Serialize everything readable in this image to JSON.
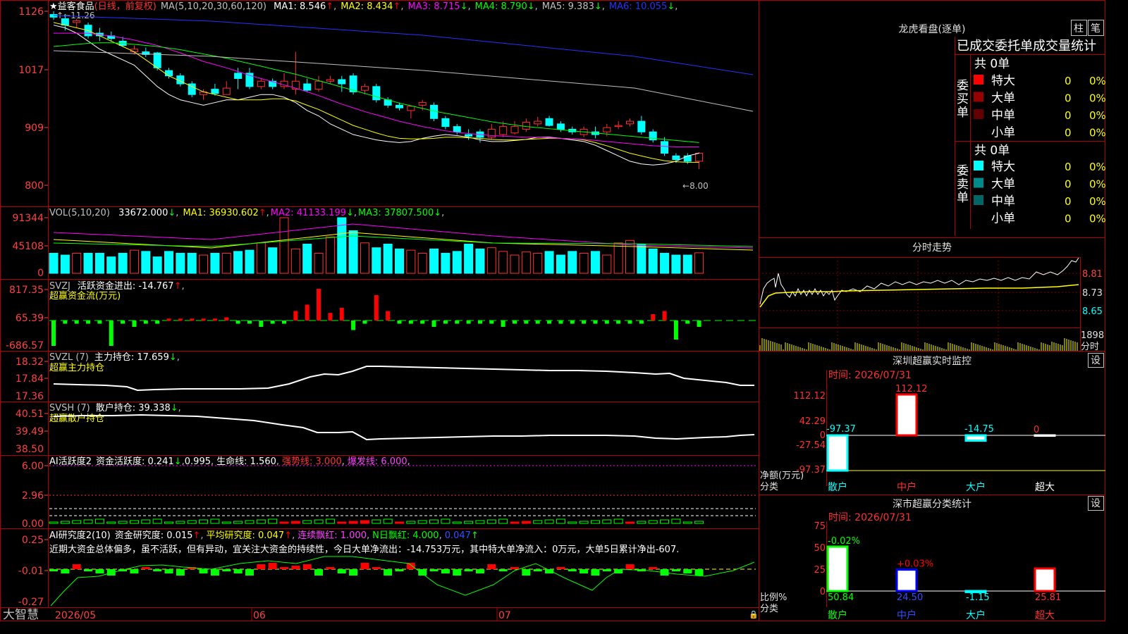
{
  "app": {
    "brand": "大智慧"
  },
  "price_panel": {
    "title": "益客食品",
    "mode": "(日线，前复权)",
    "ma_def": "MA(5,10,20,30,60,120)",
    "ma_values": [
      {
        "label": "MA1: 8.546",
        "arrow": "↑",
        "color": "#ffffff"
      },
      {
        "label": "MA2: 8.434",
        "arrow": "↑",
        "color": "#ffff00"
      },
      {
        "label": "MA3: 8.715",
        "arrow": "↓",
        "color": "#ff00ff"
      },
      {
        "label": "MA4: 8.790",
        "arrow": "↓",
        "color": "#00ff00"
      },
      {
        "label": "MA5: 9.383",
        "arrow": "↓",
        "color": "#c0c0c0"
      },
      {
        "label": "MA6: 10.055",
        "arrow": "↓",
        "color": "#2233ff"
      }
    ],
    "y_ticks": [
      "1126",
      "1017",
      "909",
      "800"
    ],
    "high_label": "11.26",
    "low_label": "8.00"
  },
  "vol_panel": {
    "def": "VOL(5,10,20)",
    "value": "33672.000",
    "value_arrow": "↓",
    "ma": [
      {
        "label": "MA1: 36930.602",
        "arrow": "↑",
        "color": "#ffff00"
      },
      {
        "label": "MA2: 41133.199",
        "arrow": "↓",
        "color": "#ff00ff"
      },
      {
        "label": "MA3: 37807.500",
        "arrow": "↓",
        "color": "#00ff00"
      }
    ],
    "y_ticks": [
      "91344",
      "45108",
      "0"
    ]
  },
  "svzj_panel": {
    "def": "SVZJ",
    "label": "活跃资金进出: -14.767",
    "arrow": "↑",
    "subtitle": "超赢资金流(万元)",
    "y_ticks": [
      "817.35",
      "65.39",
      "-686.57"
    ]
  },
  "svzl_panel": {
    "def": "SVZL (7)",
    "label": "主力持仓: 17.659",
    "arrow": "↓",
    "subtitle": "超赢主力持仓",
    "y_ticks": [
      "18.32",
      "17.84",
      "17.36"
    ]
  },
  "svsh_panel": {
    "def": "SVSH (7)",
    "label": "散户持仓: 39.338",
    "arrow": "↓",
    "subtitle": "超赢散户持仓",
    "y_ticks": [
      "40.51",
      "39.49",
      "38.50"
    ]
  },
  "ai_active_panel": {
    "title": "AI活跃度2",
    "label": "资金活跃度: 0.241",
    "arrow": "↓",
    "second": "0.995",
    "life": "生命线: 1.560",
    "strong": "强势线: 3.000",
    "burst": "爆发线: 6.000",
    "y_ticks": [
      "6.00",
      "2.96",
      "0.00"
    ]
  },
  "ai_research_panel": {
    "title": "AI研究度2(10)",
    "label": "资金研究度: 0.015",
    "avg": "平均研究度: 0.047",
    "cont": "连续飘红: 1.000",
    "nday": "N日飘红: 4.000",
    "last": "0.047",
    "comment": "近期大资金总体偏多，虽不活跃，但有异动，宜关注大资金的持续性，今日大单净流出：-14.753万元，其中特大单净流入：0万元，大单5日累计净出-607.",
    "y_ticks": [
      "0.25",
      "-0.01",
      "-0.27"
    ]
  },
  "x_axis": {
    "labels": [
      "2026/05",
      "06",
      "07"
    ]
  },
  "dragon": {
    "title": "龙虎看盘(逐单)",
    "btn1": "柱",
    "btn2": "笔",
    "header": "已成交委托单成交量统计",
    "buy_label": "委买单",
    "sell_label": "委卖单",
    "buy_total": "共 0单",
    "sell_total": "共 0单",
    "buy_rows": [
      {
        "name": "特大",
        "n": "0",
        "pct": "0%",
        "color": "#ff0000"
      },
      {
        "name": "大单",
        "n": "0",
        "pct": "0%",
        "color": "#990000"
      },
      {
        "name": "中单",
        "n": "0",
        "pct": "0%",
        "color": "#660000"
      },
      {
        "name": "小单",
        "n": "0",
        "pct": "0%",
        "color": "#000000"
      }
    ],
    "sell_rows": [
      {
        "name": "特大",
        "n": "0",
        "pct": "0%",
        "color": "#00ffff"
      },
      {
        "name": "大单",
        "n": "0",
        "pct": "0%",
        "color": "#008b8b"
      },
      {
        "name": "中单",
        "n": "0",
        "pct": "0%",
        "color": "#006666"
      },
      {
        "name": "小单",
        "n": "0",
        "pct": "0%",
        "color": "#000000"
      }
    ]
  },
  "intraday": {
    "title": "分时走势",
    "y_ticks": [
      "8.81",
      "8.73",
      "8.65"
    ],
    "vol_tick": "1898",
    "vol_unit": "分时"
  },
  "monitor": {
    "title": "深圳超赢实时监控",
    "set": "设",
    "time": "时间: 2026/07/31",
    "y_ticks": [
      "112.12",
      "42.29",
      "0",
      "-27.54",
      "-97.37"
    ],
    "unit_label": "净额(万元)",
    "cat_label": "分类",
    "bars": [
      {
        "cat": "散户",
        "value": -97.37,
        "label": "-97.37",
        "color": "#00ffff"
      },
      {
        "cat": "中户",
        "value": 112.12,
        "label": "112.12",
        "color": "#ff0000"
      },
      {
        "cat": "大户",
        "value": -14.75,
        "label": "-14.75",
        "color": "#00ffff"
      },
      {
        "cat": "超大",
        "value": 0,
        "label": "0",
        "color": "#ffffff"
      }
    ]
  },
  "classify": {
    "title": "深市超赢分类统计",
    "set": "设",
    "time": "时间: 2026/07/31",
    "y_ticks": [
      "75",
      "50",
      "25",
      "0"
    ],
    "unit_label": "比例%",
    "cat_label": "分类",
    "bars": [
      {
        "cat": "散户",
        "value": 50.84,
        "label": "50.84",
        "delta": "-0.02%",
        "delta_color": "#00ff00",
        "color": "#00ff00"
      },
      {
        "cat": "中户",
        "value": 24.5,
        "label": "24.50",
        "delta": "+0.03%",
        "delta_color": "#ff0000",
        "color": "#0000ff"
      },
      {
        "cat": "大户",
        "value": -1.15,
        "label": "-1.15",
        "delta": "",
        "delta_color": "#00ffff",
        "color": "#00ffff"
      },
      {
        "cat": "超大",
        "value": 25.81,
        "label": "25.81",
        "delta": "",
        "delta_color": "#ff0000",
        "color": "#ff0000"
      }
    ]
  },
  "chart_data": [
    {
      "type": "candlestick",
      "series": [
        {
          "name": "MA1",
          "values": [
            11.0,
            10.95,
            10.85,
            10.7,
            10.55,
            10.45,
            10.35,
            10.25,
            10.05,
            9.85,
            9.7,
            9.6,
            9.55,
            9.5,
            9.55,
            9.6,
            9.6,
            9.65,
            9.7,
            9.7,
            9.65,
            9.55,
            9.4,
            9.3,
            9.15,
            9.05,
            8.95,
            8.9,
            8.85,
            8.82,
            8.8,
            8.82,
            8.88,
            8.92,
            8.95,
            8.93,
            8.9,
            8.85,
            8.82,
            8.82,
            8.84,
            8.86,
            8.9,
            8.9,
            8.88,
            8.85,
            8.82,
            8.75,
            8.65,
            8.55,
            8.45,
            8.4,
            8.38,
            8.4,
            8.45,
            8.55,
            8.6
          ]
        },
        {
          "name": "MA2",
          "values": [
            11.05,
            11.0,
            10.95,
            10.9,
            10.8,
            10.7,
            10.6,
            10.5,
            10.35,
            10.2,
            10.05,
            9.95,
            9.85,
            9.75,
            9.7,
            9.65,
            9.6,
            9.6,
            9.6,
            9.62,
            9.62,
            9.58,
            9.5,
            9.42,
            9.32,
            9.22,
            9.12,
            9.05,
            8.98,
            8.92,
            8.88,
            8.87,
            8.87,
            8.88,
            8.9,
            8.9,
            8.89,
            8.88,
            8.86,
            8.85,
            8.85,
            8.86,
            8.87,
            8.88,
            8.88,
            8.87,
            8.85,
            8.8,
            8.74,
            8.67,
            8.6,
            8.55,
            8.5,
            8.46,
            8.44,
            8.43,
            8.43
          ]
        },
        {
          "name": "MA3",
          "values": [
            10.85,
            10.85,
            10.85,
            10.85,
            10.82,
            10.8,
            10.76,
            10.72,
            10.67,
            10.62,
            10.55,
            10.48,
            10.4,
            10.32,
            10.26,
            10.2,
            10.13,
            10.06,
            10.0,
            9.94,
            9.88,
            9.82,
            9.75,
            9.68,
            9.6,
            9.52,
            9.45,
            9.38,
            9.32,
            9.26,
            9.2,
            9.15,
            9.1,
            9.06,
            9.02,
            8.99,
            8.97,
            8.95,
            8.93,
            8.92,
            8.91,
            8.9,
            8.9,
            8.89,
            8.88,
            8.87,
            8.86,
            8.84,
            8.82,
            8.8,
            8.78,
            8.76,
            8.74,
            8.73,
            8.72,
            8.72,
            8.72
          ]
        },
        {
          "name": "MA4",
          "values": [
            10.6,
            10.62,
            10.64,
            10.66,
            10.67,
            10.67,
            10.66,
            10.64,
            10.62,
            10.6,
            10.57,
            10.54,
            10.5,
            10.46,
            10.42,
            10.38,
            10.33,
            10.28,
            10.23,
            10.18,
            10.13,
            10.08,
            10.02,
            9.96,
            9.9,
            9.84,
            9.78,
            9.72,
            9.66,
            9.6,
            9.54,
            9.49,
            9.44,
            9.39,
            9.35,
            9.31,
            9.27,
            9.23,
            9.19,
            9.16,
            9.13,
            9.1,
            9.08,
            9.06,
            9.04,
            9.02,
            9.0,
            8.98,
            8.96,
            8.94,
            8.92,
            8.9,
            8.88,
            8.86,
            8.84,
            8.82,
            8.8
          ]
        }
      ],
      "x_labels": [
        "2026/05",
        "06",
        "07"
      ],
      "yticks": [
        11.26,
        10.17,
        9.09,
        8.0
      ],
      "high": 11.26,
      "low": 8.0
    },
    {
      "type": "bar",
      "name": "VOL",
      "values": [
        33000,
        30000,
        33000,
        33000,
        33000,
        27000,
        33000,
        38000,
        36000,
        27000,
        36000,
        33000,
        33000,
        30000,
        33000,
        33000,
        36000,
        38000,
        50000,
        42000,
        91344,
        40000,
        48000,
        33000,
        60000,
        91344,
        70000,
        50000,
        42000,
        48000,
        40000,
        38000,
        33000,
        40000,
        33000,
        36000,
        48000,
        40000,
        42000,
        36000,
        30000,
        35000,
        33000,
        36000,
        30000,
        36000,
        33000,
        36000,
        30000,
        50000,
        54000,
        48000,
        40000,
        33000,
        30000,
        30000,
        33672
      ],
      "yticks": [
        91344,
        45108,
        0
      ]
    }
  ]
}
